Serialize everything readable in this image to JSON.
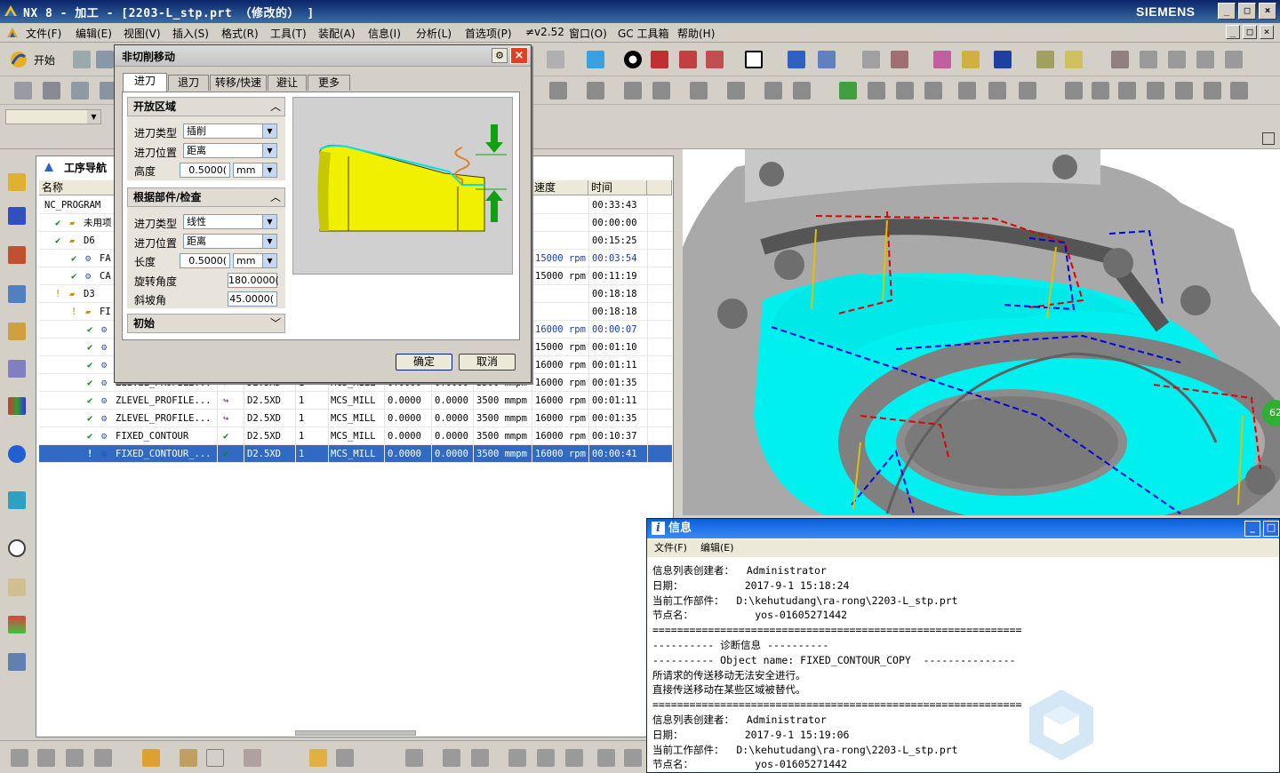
{
  "window": {
    "title": "NX 8 - 加工 - [2203-L_stp.prt （修改的） ]",
    "brand": "SIEMENS",
    "min": "_",
    "max": "□",
    "close": "×"
  },
  "menubar": {
    "items": [
      "文件(F)",
      "编辑(E)",
      "视图(V)",
      "插入(S)",
      "格式(R)",
      "工具(T)",
      "装配(A)",
      "信息(I)",
      "分析(L)",
      "首选项(P)",
      "≠v2.52",
      "窗口(O)",
      "GC 工具箱",
      "帮助(H)"
    ]
  },
  "toolbar": {
    "start_label": "开始"
  },
  "navigator": {
    "title": "工序导航",
    "columns": [
      "名称",
      "速度",
      "时间"
    ],
    "rows": [
      {
        "name": "NC_PROGRAM",
        "speed": "",
        "time": "00:33:43",
        "level": 0,
        "icon": "none"
      },
      {
        "name": "未用项",
        "speed": "",
        "time": "00:00:00",
        "level": 1,
        "icon": "folder"
      },
      {
        "name": "D6",
        "speed": "",
        "time": "00:15:25",
        "level": 1,
        "icon": "folder-check"
      },
      {
        "name": "FA",
        "speed": "15000 rpm",
        "time": "00:03:54",
        "level": 2,
        "icon": "op-blue"
      },
      {
        "name": "CA",
        "speed": "15000 rpm",
        "time": "00:11:19",
        "level": 2,
        "icon": "op"
      },
      {
        "name": "D3",
        "speed": "",
        "time": "00:18:18",
        "level": 1,
        "icon": "folder-warn"
      },
      {
        "name": "FI",
        "speed": "",
        "time": "00:18:18",
        "level": 2,
        "icon": "folder-warn"
      },
      {
        "name": "",
        "speed": "16000 rpm",
        "time": "00:00:07",
        "level": 3,
        "icon": "op-blue"
      },
      {
        "name": "",
        "speed": "15000 rpm",
        "time": "00:01:10",
        "level": 3,
        "icon": "op"
      },
      {
        "name": "",
        "speed": "16000 rpm",
        "time": "00:01:11",
        "level": 3,
        "icon": "op"
      },
      {
        "name": "ZLEVEL_PROFILE...",
        "path": "✔",
        "tool": "D2.5XD",
        "num": "1",
        "geom": "MCS_MILL",
        "v1": "0.0000",
        "v2": "0.0000",
        "feed": "3500 mmpm",
        "speed": "16000 rpm",
        "time": "00:01:35",
        "level": 3,
        "icon": "op"
      },
      {
        "name": "ZLEVEL_PROFILE...",
        "path": "↪",
        "tool": "D2.5XD",
        "num": "1",
        "geom": "MCS_MILL",
        "v1": "0.0000",
        "v2": "0.0000",
        "feed": "3500 mmpm",
        "speed": "16000 rpm",
        "time": "00:01:11",
        "level": 3,
        "icon": "op"
      },
      {
        "name": "ZLEVEL_PROFILE...",
        "path": "↪",
        "tool": "D2.5XD",
        "num": "1",
        "geom": "MCS_MILL",
        "v1": "0.0000",
        "v2": "0.0000",
        "feed": "3500 mmpm",
        "speed": "16000 rpm",
        "time": "00:01:35",
        "level": 3,
        "icon": "op"
      },
      {
        "name": "FIXED_CONTOUR",
        "path": "✔",
        "tool": "D2.5XD",
        "num": "1",
        "geom": "MCS_MILL",
        "v1": "0.0000",
        "v2": "0.0000",
        "feed": "3500 mmpm",
        "speed": "16000 rpm",
        "time": "00:10:37",
        "level": 3,
        "icon": "op"
      },
      {
        "name": "FIXED_CONTOUR_...",
        "path": "✔",
        "tool": "D2.5XD",
        "num": "1",
        "geom": "MCS_MILL",
        "v1": "0.0000",
        "v2": "0.0000",
        "feed": "3500 mmpm",
        "speed": "16000 rpm",
        "time": "00:00:41",
        "level": 3,
        "icon": "op",
        "selected": true,
        "warn": true
      }
    ]
  },
  "dialog": {
    "title": "非切削移动",
    "tabs": [
      "进刀",
      "退刀",
      "转移/快速",
      "避让",
      "更多"
    ],
    "open_area": {
      "header": "开放区域",
      "type_label": "进刀类型",
      "type_value": "插削",
      "pos_label": "进刀位置",
      "pos_value": "距离",
      "height_label": "高度",
      "height_value": "0.5000(",
      "height_unit": "mm"
    },
    "closed_area": {
      "header": "根据部件/检查",
      "type_label": "进刀类型",
      "type_value": "线性",
      "pos_label": "进刀位置",
      "pos_value": "距离",
      "length_label": "长度",
      "length_value": "0.5000(",
      "length_unit": "mm",
      "rot_label": "旋转角度",
      "rot_value": "180.0000(",
      "ramp_label": "斜坡角",
      "ramp_value": "45.0000("
    },
    "initial_header": "初始",
    "ok_label": "确定",
    "cancel_label": "取消"
  },
  "info": {
    "title": "信息",
    "menu": [
      "文件(F)",
      "编辑(E)"
    ],
    "lines": [
      "信息列表创建者：  Administrator",
      "日期：          2017-9-1 15:18:24",
      "当前工作部件：  D:\\kehutudang\\ra-rong\\2203-L_stp.prt",
      "节点名：          yos-01605271442",
      "============================================================",
      "---------- 诊断信息 ----------",
      "---------- Object name: FIXED_CONTOUR_COPY  ---------------",
      "所请求的传送移动无法安全进行。",
      "直接传送移动在某些区域被替代。",
      "============================================================",
      "信息列表创建者：  Administrator",
      "日期：          2017-9-1 15:19:06",
      "当前工作部件：  D:\\kehutudang\\ra-rong\\2203-L_stp.prt",
      "节点名：          yos-01605271442"
    ]
  },
  "viewport_badge": "62",
  "colors": {
    "accent": "#316ac5",
    "cyan": "#00f0f0",
    "titlebar": "#0a246a"
  }
}
